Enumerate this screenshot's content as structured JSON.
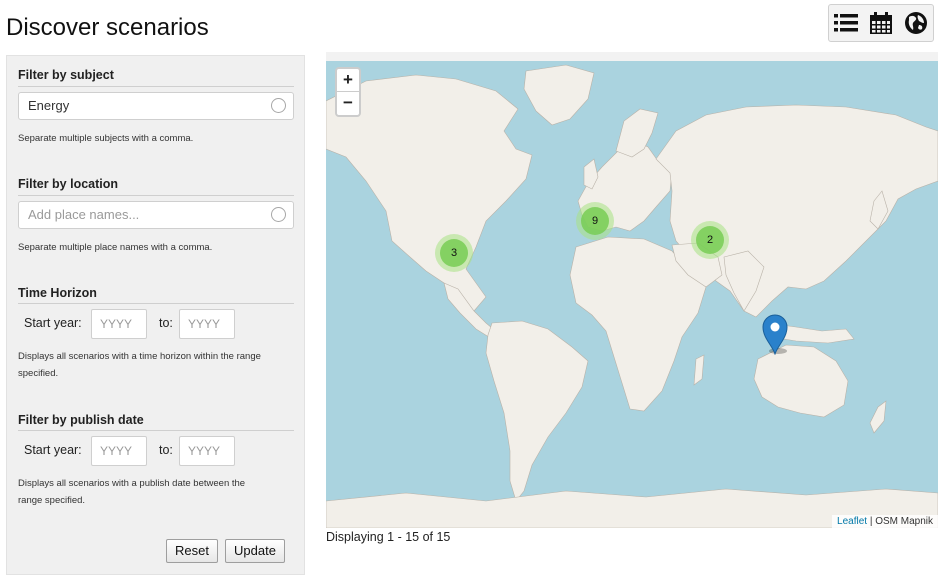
{
  "header": {
    "title": "Discover scenarios",
    "views": [
      {
        "name": "list-view",
        "icon": "list-icon"
      },
      {
        "name": "calendar-view",
        "icon": "calendar-icon"
      },
      {
        "name": "map-view",
        "icon": "globe-icon"
      }
    ]
  },
  "filters": {
    "subject": {
      "label": "Filter by subject",
      "value": "Energy",
      "help": "Separate multiple subjects with a comma."
    },
    "location": {
      "label": "Filter by location",
      "placeholder": "Add place names...",
      "help": "Separate multiple place names with a comma."
    },
    "time_horizon": {
      "label": "Time Horizon",
      "start_label": "Start year:",
      "start_placeholder": "YYYY",
      "to_label": "to:",
      "end_placeholder": "YYYY",
      "help_line1": "Displays all scenarios with a time horizon within the range",
      "help_line2": "specified."
    },
    "publish_date": {
      "label": "Filter by publish date",
      "start_label": "Start year:",
      "start_placeholder": "YYYY",
      "to_label": "to:",
      "end_placeholder": "YYYY",
      "help_line1": "Displays all scenarios with a publish date between the",
      "help_line2": "range specified."
    },
    "reset_label": "Reset",
    "update_label": "Update"
  },
  "map": {
    "zoom_in": "+",
    "zoom_out": "−",
    "clusters": [
      {
        "region": "north-america",
        "count": "3"
      },
      {
        "region": "europe",
        "count": "9"
      },
      {
        "region": "asia",
        "count": "2"
      }
    ],
    "marker": "australia",
    "attribution_link": "Leaflet",
    "attribution_text": " | OSM Mapnik",
    "ocean_color": "#aad3df",
    "land_color": "#f2efe9",
    "cluster_color": "#78cd55",
    "marker_color": "#2a81cb"
  },
  "results": {
    "text": "Displaying 1 - 15 of 15"
  }
}
